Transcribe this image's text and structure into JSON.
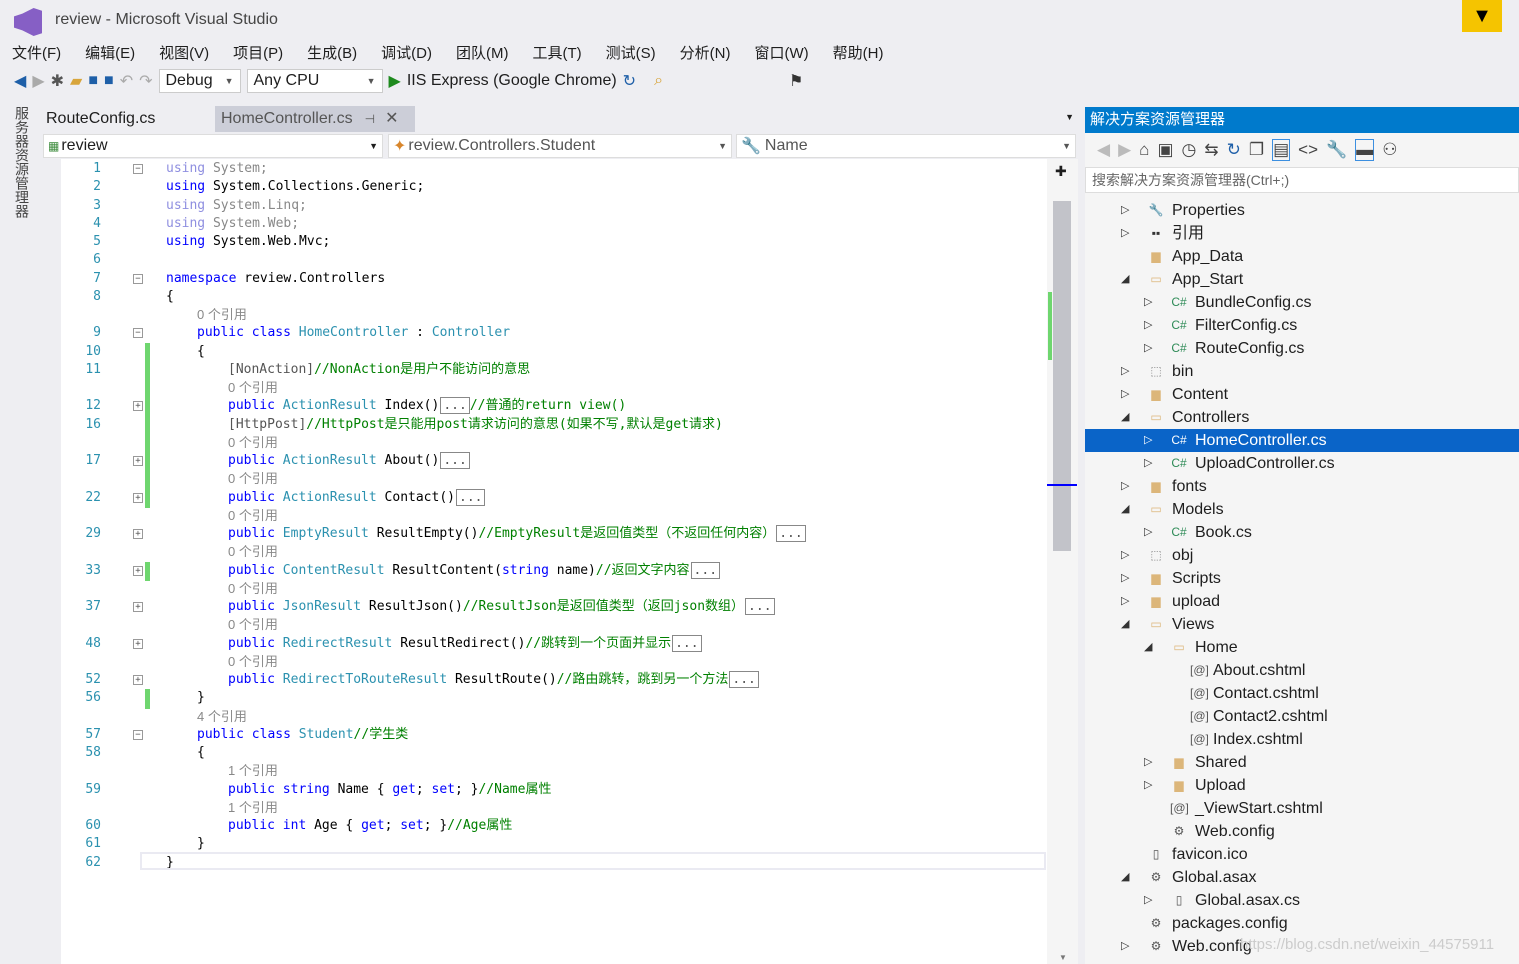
{
  "window": {
    "title": "review - Microsoft Visual Studio"
  },
  "menu": [
    "文件(F)",
    "编辑(E)",
    "视图(V)",
    "项目(P)",
    "生成(B)",
    "调试(D)",
    "团队(M)",
    "工具(T)",
    "测试(S)",
    "分析(N)",
    "窗口(W)",
    "帮助(H)"
  ],
  "toolbar": {
    "config": "Debug",
    "platform": "Any CPU",
    "run": "IIS Express (Google Chrome)"
  },
  "left_tab": "服务器资源管理器",
  "tabs": [
    {
      "label": "RouteConfig.cs",
      "active": true
    },
    {
      "label": "HomeController.cs",
      "active": false
    }
  ],
  "nav": {
    "project": "review",
    "type": "review.Controllers.Student",
    "member": "Name"
  },
  "code": [
    {
      "n": "1",
      "i": 0,
      "fold": "-",
      "t": [
        [
          "f",
          "using"
        ],
        [
          "fg",
          " System;"
        ]
      ]
    },
    {
      "n": "2",
      "i": 0,
      "t": [
        [
          "k",
          "using"
        ],
        [
          "n",
          " System.Collections.Generic;"
        ]
      ]
    },
    {
      "n": "3",
      "i": 0,
      "t": [
        [
          "f",
          "using"
        ],
        [
          "fg",
          " System.Linq;"
        ]
      ]
    },
    {
      "n": "4",
      "i": 0,
      "t": [
        [
          "f",
          "using"
        ],
        [
          "fg",
          " System.Web;"
        ]
      ]
    },
    {
      "n": "5",
      "i": 0,
      "t": [
        [
          "k",
          "using"
        ],
        [
          "n",
          " System.Web.Mvc;"
        ]
      ]
    },
    {
      "n": "6",
      "i": 0,
      "t": []
    },
    {
      "n": "7",
      "i": 0,
      "fold": "-",
      "t": [
        [
          "k",
          "namespace"
        ],
        [
          "n",
          " review.Controllers"
        ]
      ]
    },
    {
      "n": "8",
      "i": 0,
      "t": [
        [
          "n",
          "{"
        ]
      ]
    },
    {
      "n": "",
      "i": 1,
      "t": [
        [
          "g",
          "0 个引用"
        ]
      ]
    },
    {
      "n": "9",
      "i": 1,
      "fold": "-",
      "t": [
        [
          "k",
          "public class"
        ],
        [
          "t",
          " HomeController"
        ],
        [
          "n",
          " : "
        ],
        [
          "t",
          "Controller"
        ]
      ]
    },
    {
      "n": "10",
      "i": 1,
      "t": [
        [
          "n",
          "{"
        ]
      ]
    },
    {
      "n": "11",
      "i": 2,
      "t": [
        [
          "a",
          "[NonAction]"
        ],
        [
          "c",
          "//NonAction是用户不能访问的意思"
        ]
      ]
    },
    {
      "n": "",
      "i": 2,
      "t": [
        [
          "g",
          "0 个引用"
        ]
      ]
    },
    {
      "n": "12",
      "i": 2,
      "fold": "+",
      "t": [
        [
          "k",
          "public"
        ],
        [
          "t",
          " ActionResult"
        ],
        [
          "n",
          " Index()"
        ],
        [
          "box",
          "..."
        ],
        [
          "c",
          "//普通的return view()"
        ]
      ]
    },
    {
      "n": "16",
      "i": 2,
      "t": [
        [
          "a",
          "[HttpPost]"
        ],
        [
          "c",
          "//HttpPost是只能用post请求访问的意思(如果不写,默认是get请求)"
        ]
      ]
    },
    {
      "n": "",
      "i": 2,
      "t": [
        [
          "g",
          "0 个引用"
        ]
      ]
    },
    {
      "n": "17",
      "i": 2,
      "fold": "+",
      "t": [
        [
          "k",
          "public"
        ],
        [
          "t",
          " ActionResult"
        ],
        [
          "n",
          " About()"
        ],
        [
          "box",
          "..."
        ]
      ]
    },
    {
      "n": "",
      "i": 2,
      "t": [
        [
          "g",
          "0 个引用"
        ]
      ]
    },
    {
      "n": "22",
      "i": 2,
      "fold": "+",
      "t": [
        [
          "k",
          "public"
        ],
        [
          "t",
          " ActionResult"
        ],
        [
          "n",
          " Contact()"
        ],
        [
          "box",
          "..."
        ]
      ]
    },
    {
      "n": "",
      "i": 2,
      "t": [
        [
          "g",
          "0 个引用"
        ]
      ]
    },
    {
      "n": "29",
      "i": 2,
      "fold": "+",
      "t": [
        [
          "k",
          "public"
        ],
        [
          "t",
          " EmptyResult"
        ],
        [
          "n",
          " ResultEmpty()"
        ],
        [
          "c",
          "//EmptyResult是返回值类型（不返回任何内容）"
        ],
        [
          "box",
          "..."
        ]
      ]
    },
    {
      "n": "",
      "i": 2,
      "t": [
        [
          "g",
          "0 个引用"
        ]
      ]
    },
    {
      "n": "33",
      "i": 2,
      "fold": "+",
      "t": [
        [
          "k",
          "public"
        ],
        [
          "t",
          " ContentResult"
        ],
        [
          "n",
          " ResultContent("
        ],
        [
          "k",
          "string"
        ],
        [
          "n",
          " name)"
        ],
        [
          "c",
          "//返回文字内容"
        ],
        [
          "box",
          "..."
        ]
      ]
    },
    {
      "n": "",
      "i": 2,
      "t": [
        [
          "g",
          "0 个引用"
        ]
      ]
    },
    {
      "n": "37",
      "i": 2,
      "fold": "+",
      "t": [
        [
          "k",
          "public"
        ],
        [
          "t",
          " JsonResult"
        ],
        [
          "n",
          " ResultJson()"
        ],
        [
          "c",
          "//ResultJson是返回值类型（返回json数组）"
        ],
        [
          "box",
          "..."
        ]
      ]
    },
    {
      "n": "",
      "i": 2,
      "t": [
        [
          "g",
          "0 个引用"
        ]
      ]
    },
    {
      "n": "48",
      "i": 2,
      "fold": "+",
      "t": [
        [
          "k",
          "public"
        ],
        [
          "t",
          " RedirectResult"
        ],
        [
          "n",
          " ResultRedirect()"
        ],
        [
          "c",
          "//跳转到一个页面并显示"
        ],
        [
          "box",
          "..."
        ]
      ]
    },
    {
      "n": "",
      "i": 2,
      "t": [
        [
          "g",
          "0 个引用"
        ]
      ]
    },
    {
      "n": "52",
      "i": 2,
      "fold": "+",
      "t": [
        [
          "k",
          "public"
        ],
        [
          "t",
          " RedirectToRouteResult"
        ],
        [
          "n",
          " ResultRoute()"
        ],
        [
          "c",
          "//路由跳转，跳到另一个方法"
        ],
        [
          "box",
          "..."
        ]
      ]
    },
    {
      "n": "56",
      "i": 1,
      "t": [
        [
          "n",
          "}"
        ]
      ]
    },
    {
      "n": "",
      "i": 1,
      "t": [
        [
          "g",
          "4 个引用"
        ]
      ]
    },
    {
      "n": "57",
      "i": 1,
      "fold": "-",
      "t": [
        [
          "k",
          "public class"
        ],
        [
          "t",
          " Student"
        ],
        [
          "c",
          "//学生类"
        ]
      ]
    },
    {
      "n": "58",
      "i": 1,
      "t": [
        [
          "n",
          "{"
        ]
      ]
    },
    {
      "n": "",
      "i": 2,
      "t": [
        [
          "g",
          "1 个引用"
        ]
      ]
    },
    {
      "n": "59",
      "i": 2,
      "t": [
        [
          "k",
          "public string"
        ],
        [
          "n",
          " Name { "
        ],
        [
          "k",
          "get"
        ],
        [
          "n",
          "; "
        ],
        [
          "k",
          "set"
        ],
        [
          "n",
          "; }"
        ],
        [
          "c",
          "//Name属性"
        ]
      ]
    },
    {
      "n": "",
      "i": 2,
      "t": [
        [
          "g",
          "1 个引用"
        ]
      ]
    },
    {
      "n": "60",
      "i": 2,
      "t": [
        [
          "k",
          "public int"
        ],
        [
          "n",
          " Age { "
        ],
        [
          "k",
          "get"
        ],
        [
          "n",
          "; "
        ],
        [
          "k",
          "set"
        ],
        [
          "n",
          "; }"
        ],
        [
          "c",
          "//Age属性"
        ]
      ]
    },
    {
      "n": "61",
      "i": 1,
      "t": [
        [
          "n",
          "}"
        ]
      ]
    },
    {
      "n": "62",
      "i": 0,
      "t": [
        [
          "n",
          "}"
        ]
      ]
    }
  ],
  "solution_explorer": {
    "title": "解决方案资源管理器",
    "search_placeholder": "搜索解决方案资源管理器(Ctrl+;)",
    "items": [
      {
        "label": "Properties",
        "level": 0,
        "arrow": "right",
        "icon": "wrench"
      },
      {
        "label": "引用",
        "level": 0,
        "arrow": "right",
        "icon": "references"
      },
      {
        "label": "App_Data",
        "level": 0,
        "arrow": "",
        "icon": "folder"
      },
      {
        "label": "App_Start",
        "level": 0,
        "arrow": "down",
        "icon": "folder-open"
      },
      {
        "label": "BundleConfig.cs",
        "level": 1,
        "arrow": "right",
        "icon": "cs"
      },
      {
        "label": "FilterConfig.cs",
        "level": 1,
        "arrow": "right",
        "icon": "cs"
      },
      {
        "label": "RouteConfig.cs",
        "level": 1,
        "arrow": "right",
        "icon": "cs"
      },
      {
        "label": "bin",
        "level": 0,
        "arrow": "right",
        "icon": "folder-dotted"
      },
      {
        "label": "Content",
        "level": 0,
        "arrow": "right",
        "icon": "folder"
      },
      {
        "label": "Controllers",
        "level": 0,
        "arrow": "down",
        "icon": "folder-open"
      },
      {
        "label": "HomeController.cs",
        "level": 1,
        "arrow": "right",
        "icon": "cs",
        "selected": true
      },
      {
        "label": "UploadController.cs",
        "level": 1,
        "arrow": "right",
        "icon": "cs"
      },
      {
        "label": "fonts",
        "level": 0,
        "arrow": "right",
        "icon": "folder"
      },
      {
        "label": "Models",
        "level": 0,
        "arrow": "down",
        "icon": "folder-open"
      },
      {
        "label": "Book.cs",
        "level": 1,
        "arrow": "right",
        "icon": "cs"
      },
      {
        "label": "obj",
        "level": 0,
        "arrow": "right",
        "icon": "folder-dotted"
      },
      {
        "label": "Scripts",
        "level": 0,
        "arrow": "right",
        "icon": "folder"
      },
      {
        "label": "upload",
        "level": 0,
        "arrow": "right",
        "icon": "folder"
      },
      {
        "label": "Views",
        "level": 0,
        "arrow": "down",
        "icon": "folder-open"
      },
      {
        "label": "Home",
        "level": 1,
        "arrow": "down",
        "icon": "folder-open"
      },
      {
        "label": "About.cshtml",
        "level": 2,
        "arrow": "",
        "icon": "cshtml"
      },
      {
        "label": "Contact.cshtml",
        "level": 2,
        "arrow": "",
        "icon": "cshtml"
      },
      {
        "label": "Contact2.cshtml",
        "level": 2,
        "arrow": "",
        "icon": "cshtml"
      },
      {
        "label": "Index.cshtml",
        "level": 2,
        "arrow": "",
        "icon": "cshtml"
      },
      {
        "label": "Shared",
        "level": 1,
        "arrow": "right",
        "icon": "folder"
      },
      {
        "label": "Upload",
        "level": 1,
        "arrow": "right",
        "icon": "folder"
      },
      {
        "label": "_ViewStart.cshtml",
        "level": 1,
        "arrow": "",
        "icon": "cshtml"
      },
      {
        "label": "Web.config",
        "level": 1,
        "arrow": "",
        "icon": "config"
      },
      {
        "label": "favicon.ico",
        "level": 0,
        "arrow": "",
        "icon": "file"
      },
      {
        "label": "Global.asax",
        "level": 0,
        "arrow": "down",
        "icon": "global"
      },
      {
        "label": "Global.asax.cs",
        "level": 1,
        "arrow": "right",
        "icon": "file"
      },
      {
        "label": "packages.config",
        "level": 0,
        "arrow": "",
        "icon": "config"
      },
      {
        "label": "Web.config",
        "level": 0,
        "arrow": "right",
        "icon": "config"
      }
    ]
  },
  "watermark": "https://blog.csdn.net/weixin_44575911",
  "colors": {
    "accent": "#007acc",
    "selection": "#0a64c8",
    "keyword": "#0000ff",
    "type": "#2b91af",
    "comment": "#008000",
    "changed": "#6fd66f"
  }
}
